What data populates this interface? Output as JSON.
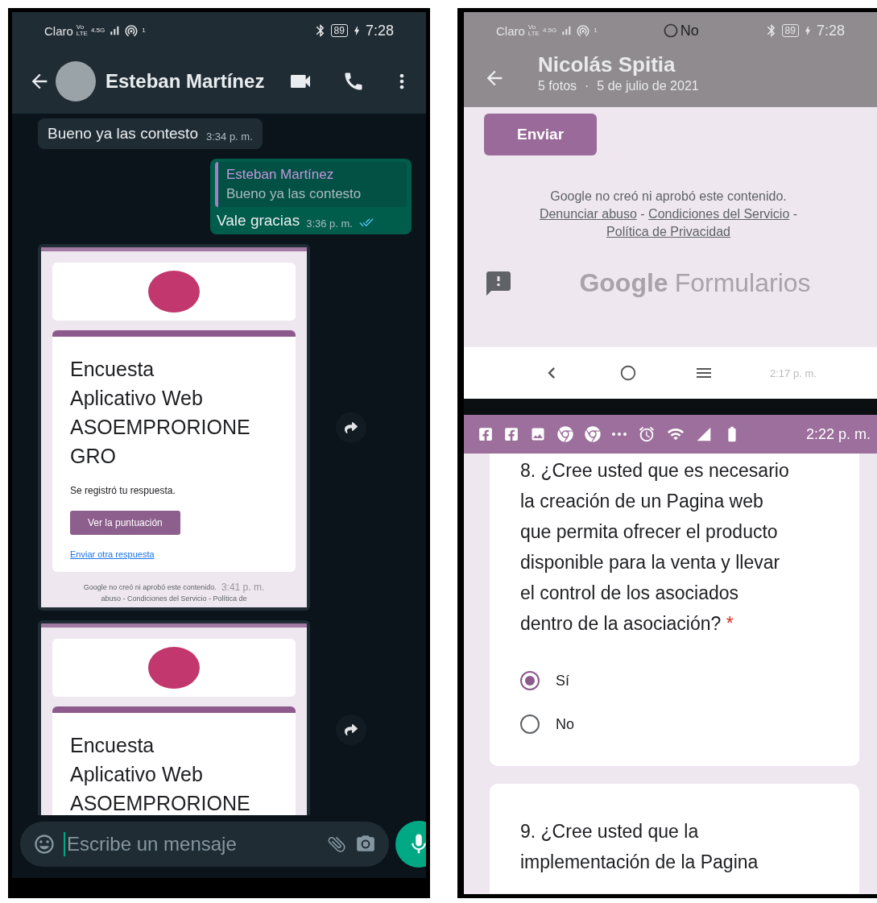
{
  "left_phone": {
    "status_bar": {
      "carrier": "Claro",
      "volte": [
        "Vo",
        "LTE"
      ],
      "network": "4.5G",
      "sim": "1",
      "battery": "89",
      "time": "7:28"
    },
    "chat_header": {
      "contact": "Esteban Martínez"
    },
    "messages": [
      {
        "kind": "text",
        "text": "Bueno ya las contesto",
        "time": "3:34 p. m."
      },
      {
        "kind": "reply",
        "quote_author": "Esteban Martínez",
        "quote_text": "Bueno ya las contesto",
        "text": "Vale gracias",
        "time": "3:36 p. m.",
        "read": true
      },
      {
        "kind": "form_image",
        "title_lines": [
          "Encuesta",
          "Aplicativo Web",
          "ASOEMPRORIONE",
          "GRO"
        ],
        "confirmation": "Se registró tu respuesta.",
        "score_button": "Ver la puntuación",
        "link": "Enviar otra respuesta",
        "footer": [
          "Google no creó ni aprobó este contenido.",
          "abuso - Condiciones del Servicio - Política de"
        ],
        "time": "3:41 p. m."
      },
      {
        "kind": "form_image",
        "title_lines": [
          "Encuesta",
          "Aplicativo Web",
          "ASOEMPRORIONE"
        ]
      }
    ],
    "composer": {
      "placeholder": "Escribe un mensaje"
    }
  },
  "right_phone": {
    "status_bar": {
      "carrier": "Claro",
      "volte": [
        "Vo",
        "LTE"
      ],
      "network": "4.5G",
      "sim": "1",
      "battery": "89",
      "time": "7:28"
    },
    "ghost_option": "No",
    "viewer_header": {
      "title": "Nicolás Spitia",
      "count": "5 fotos",
      "separator": "·",
      "date": "5 de julio de 2021"
    },
    "form_footer": {
      "submit": "Enviar",
      "disclaimer": "Google no creó ni aprobó este contenido.",
      "links": [
        "Denunciar abuso",
        "Condiciones del Servicio",
        "Política de Privacidad"
      ],
      "separator": "-",
      "brand": "Google",
      "product": "Formularios"
    },
    "nav_bar": {
      "time": "2:17 p. m."
    },
    "notification_bar": {
      "time": "2:22 p. m."
    },
    "questions": [
      {
        "text": "8. ¿Cree usted que es necesario la creación de un Pagina web que permita ofrecer el producto disponible para la venta y llevar el control de los asociados dentro de la asociación?",
        "required_mark": "*",
        "options": [
          {
            "label": "Sí",
            "selected": true
          },
          {
            "label": "No",
            "selected": false
          }
        ]
      },
      {
        "text": "9. ¿Cree usted que la implementación de la Pagina"
      }
    ]
  }
}
